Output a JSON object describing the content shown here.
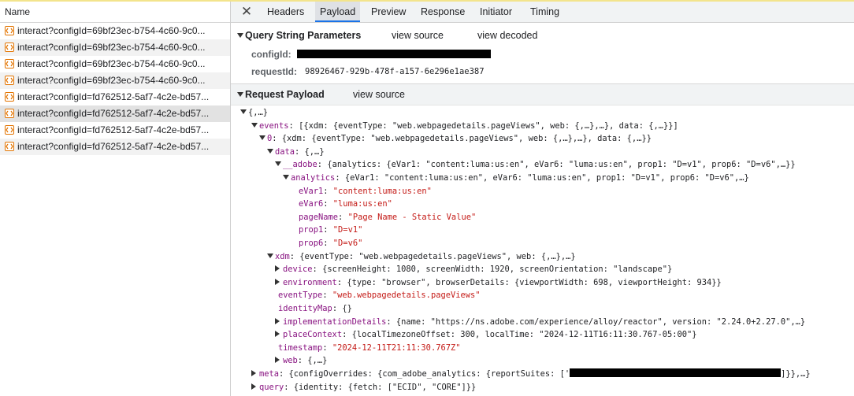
{
  "left_panel": {
    "header": "Name",
    "requests": [
      {
        "name": "interact?configId=69bf23ec-b754-4c60-9c0..."
      },
      {
        "name": "interact?configId=69bf23ec-b754-4c60-9c0..."
      },
      {
        "name": "interact?configId=69bf23ec-b754-4c60-9c0..."
      },
      {
        "name": "interact?configId=69bf23ec-b754-4c60-9c0..."
      },
      {
        "name": "interact?configId=fd762512-5af7-4c2e-bd57..."
      },
      {
        "name": "interact?configId=fd762512-5af7-4c2e-bd57..."
      },
      {
        "name": "interact?configId=fd762512-5af7-4c2e-bd57..."
      },
      {
        "name": "interact?configId=fd762512-5af7-4c2e-bd57..."
      }
    ]
  },
  "tabs": [
    "Headers",
    "Payload",
    "Preview",
    "Response",
    "Initiator",
    "Timing"
  ],
  "active_tab": "Payload",
  "query_string": {
    "title": "Query String Parameters",
    "view_source": "view source",
    "view_decoded": "view decoded",
    "config_label": "configId:",
    "request_label": "requestId:",
    "request_value": "98926467-929b-478f-a157-6e296e1ae387"
  },
  "request_payload": {
    "title": "Request Payload",
    "view_source": "view source",
    "lines": [
      {
        "ind": 0,
        "tog": "down",
        "key": "",
        "val": "{,…}",
        "vc": "grey"
      },
      {
        "ind": 1,
        "tog": "down",
        "key": "events",
        "val": "[{xdm: {eventType: \"web.webpagedetails.pageViews\", web: {,…},…}, data: {,…}}]",
        "vc": "grey"
      },
      {
        "ind": 2,
        "tog": "down",
        "key": "0",
        "val": "{xdm: {eventType: \"web.webpagedetails.pageViews\", web: {,…},…}, data: {,…}}",
        "vc": "grey"
      },
      {
        "ind": 3,
        "tog": "down",
        "key": "data",
        "val": "{,…}",
        "vc": "grey"
      },
      {
        "ind": 4,
        "tog": "down",
        "key": "__adobe",
        "val": "{analytics: {eVar1: \"content:luma:us:en\", eVar6: \"luma:us:en\", prop1: \"D=v1\", prop6: \"D=v6\",…}}",
        "vc": "grey"
      },
      {
        "ind": 5,
        "tog": "down",
        "key": "analytics",
        "val": "{eVar1: \"content:luma:us:en\", eVar6: \"luma:us:en\", prop1: \"D=v1\", prop6: \"D=v6\",…}",
        "vc": "grey"
      },
      {
        "ind": 6,
        "tog": "none",
        "key": "eVar1",
        "val": "\"content:luma:us:en\"",
        "vc": "str"
      },
      {
        "ind": 6,
        "tog": "none",
        "key": "eVar6",
        "val": "\"luma:us:en\"",
        "vc": "str"
      },
      {
        "ind": 6,
        "tog": "none",
        "key": "pageName",
        "val": "\"Page Name - Static Value\"",
        "vc": "str"
      },
      {
        "ind": 6,
        "tog": "none",
        "key": "prop1",
        "val": "\"D=v1\"",
        "vc": "str"
      },
      {
        "ind": 6,
        "tog": "none",
        "key": "prop6",
        "val": "\"D=v6\"",
        "vc": "str"
      },
      {
        "ind": 3,
        "tog": "down",
        "key": "xdm",
        "val": "{eventType: \"web.webpagedetails.pageViews\", web: {,…},…}",
        "vc": "grey"
      },
      {
        "ind": 4,
        "tog": "right",
        "key": "device",
        "val": "{screenHeight: 1080, screenWidth: 1920, screenOrientation: \"landscape\"}",
        "vc": "grey"
      },
      {
        "ind": 4,
        "tog": "right",
        "key": "environment",
        "val": "{type: \"browser\", browserDetails: {viewportWidth: 698, viewportHeight: 934}}",
        "vc": "grey"
      },
      {
        "ind": 4,
        "tog": "none",
        "key": "eventType",
        "val": "\"web.webpagedetails.pageViews\"",
        "vc": "str"
      },
      {
        "ind": 4,
        "tog": "none",
        "key": "identityMap",
        "val": "{}",
        "vc": "grey"
      },
      {
        "ind": 4,
        "tog": "right",
        "key": "implementationDetails",
        "val": "{name: \"https://ns.adobe.com/experience/alloy/reactor\", version: \"2.24.0+2.27.0\",…}",
        "vc": "grey"
      },
      {
        "ind": 4,
        "tog": "right",
        "key": "placeContext",
        "val": "{localTimezoneOffset: 300, localTime: \"2024-12-11T16:11:30.767-05:00\"}",
        "vc": "grey"
      },
      {
        "ind": 4,
        "tog": "none",
        "key": "timestamp",
        "val": "\"2024-12-11T21:11:30.767Z\"",
        "vc": "str"
      },
      {
        "ind": 4,
        "tog": "right",
        "key": "web",
        "val": "{,…}",
        "vc": "grey"
      },
      {
        "ind": 1,
        "tog": "right",
        "key": "meta",
        "val": "{configOverrides: {com_adobe_analytics: {reportSuites: ['",
        "vc": "grey",
        "tail": "]}},…}"
      },
      {
        "ind": 1,
        "tog": "right",
        "key": "query",
        "val": "{identity: {fetch: [\"ECID\", \"CORE\"]}}",
        "vc": "grey"
      }
    ]
  }
}
